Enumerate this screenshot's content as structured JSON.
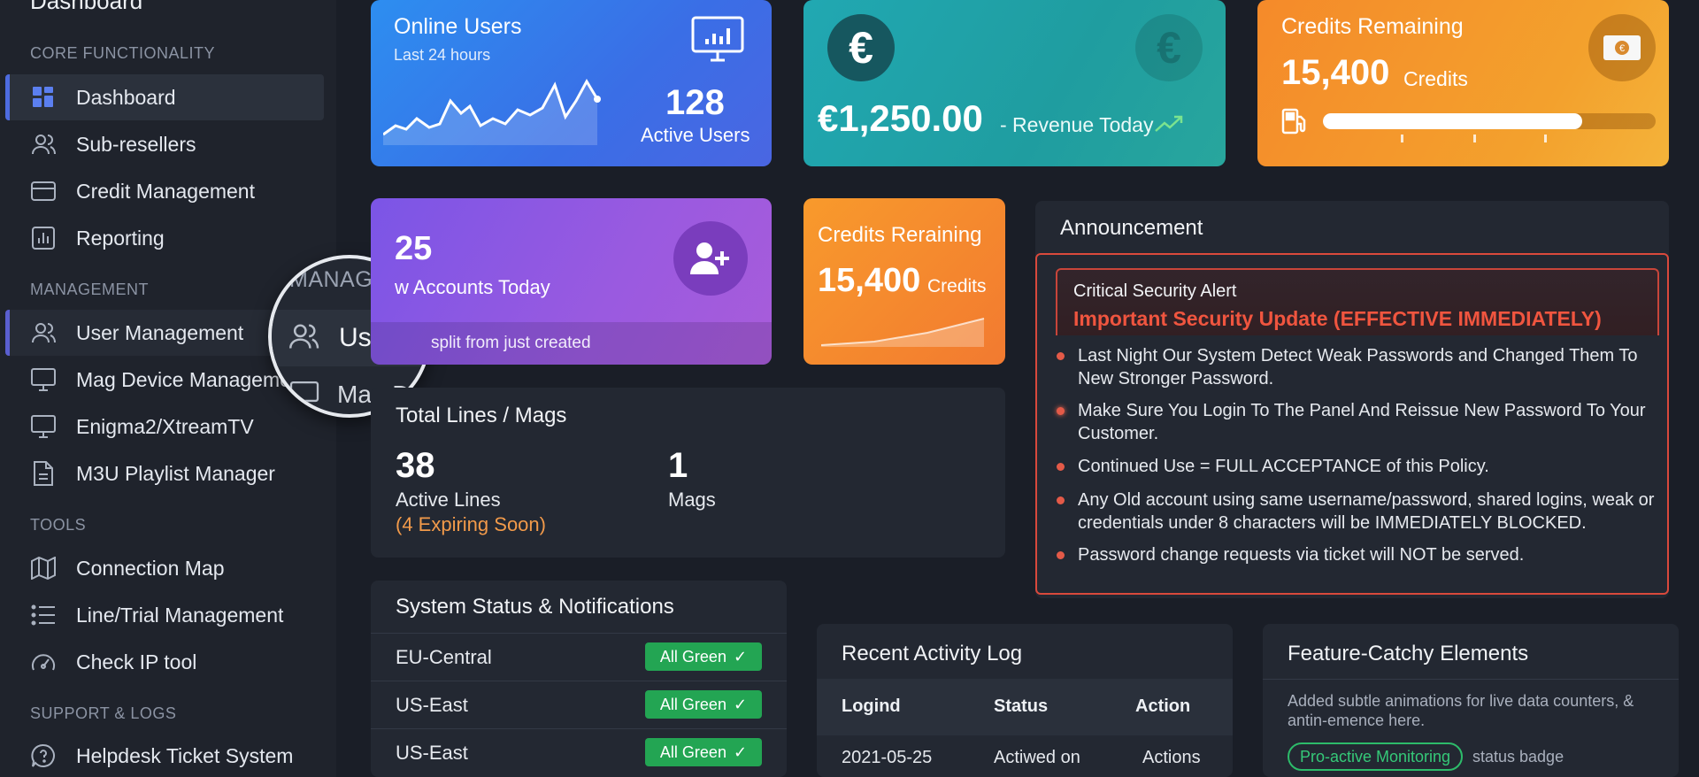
{
  "sidebar": {
    "title": "Dashboard",
    "sections": {
      "core": "CORE FUNCTIONALITY",
      "management": "MANAGEMENT",
      "tools": "TOOLS",
      "support": "SUPPORT & LOGS"
    },
    "items": {
      "dashboard": "Dashboard",
      "subresellers": "Sub-resellers",
      "credit": "Credit Management",
      "reporting": "Reporting",
      "user_mgmt": "User Management",
      "mag": "Mag Device Managemen",
      "enigma": "Enigma2/XtreamTV",
      "m3u": "M3U Playlist Manager",
      "connection": "Connection Map",
      "line_trial": "Line/Trial Management",
      "check_ip": "Check IP tool",
      "helpdesk": "Helpdesk Ticket System"
    }
  },
  "magnifier": {
    "section": "MANAGEME",
    "label": "Users",
    "next": "Mag D"
  },
  "cards": {
    "online": {
      "title": "Online Users",
      "sub": "Last 24 hours",
      "value": "128",
      "caption": "Active Users"
    },
    "revenue": {
      "value": "€1,250.00",
      "caption": "- Revenue Today",
      "symbol": "€"
    },
    "credits": {
      "title": "Credits Remaining",
      "value": "15,400",
      "unit": "Credits",
      "level": 0.78
    },
    "accounts": {
      "value": "25",
      "caption": "w Accounts Today",
      "footer": "split from just created"
    },
    "credits2": {
      "title": "Credits Reraining",
      "value": "15,400",
      "unit": "Credits"
    }
  },
  "total": {
    "title": "Total Lines / Mags",
    "lines_value": "38",
    "lines_label": "Active Lines",
    "lines_note": "(4 Expiring Soon)",
    "mags_value": "1",
    "mags_label": "Mags"
  },
  "announcement": {
    "title": "Announcement",
    "alert_label": "Critical Security Alert",
    "alert_heading": "Important Security Update (EFFECTIVE IMMEDIATELY)",
    "bullets": [
      "Last Night Our System Detect Weak Passwords and Changed Them To New Stronger Password.",
      "Make Sure You Login To The Panel And Reissue New Password To Your Customer.",
      "Continued Use = FULL ACCEPTANCE of this Policy.",
      "Any Old account using same username/password, shared logins, weak or credentials under 8 characters will be IMMEDIATELY BLOCKED.",
      "Password change requests via ticket will NOT be served."
    ]
  },
  "status": {
    "title": "System Status & Notifications",
    "rows": [
      {
        "name": "EU-Central",
        "badge": "All Green"
      },
      {
        "name": "US-East",
        "badge": "All Green"
      },
      {
        "name": "US-East",
        "badge": "All Green"
      }
    ]
  },
  "activity": {
    "title": "Recent Activity Log",
    "headers": [
      "Logind",
      "Status",
      "Action"
    ],
    "row": [
      "2021-05-25",
      "Actiwed on",
      "Actions"
    ]
  },
  "feature": {
    "title": "Feature-Catchy Elements",
    "text": "Added subtle animations for live data counters, & antin-emence here.",
    "badge": "Pro-active Monitoring",
    "badge_caption": "status badge"
  },
  "colors": {
    "accent": "#4d6be0",
    "green": "#23a553",
    "alert": "#e35a48",
    "orange_note": "#f29a4a"
  }
}
